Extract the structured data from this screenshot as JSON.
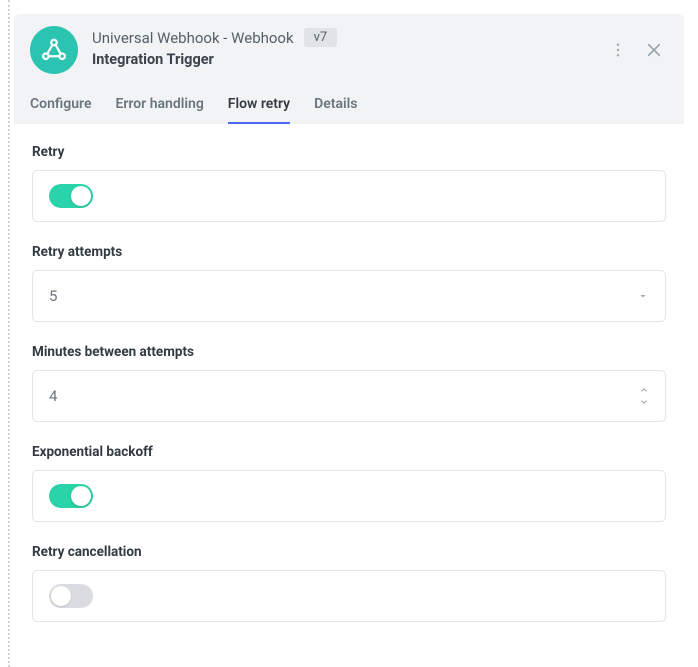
{
  "header": {
    "title": "Universal Webhook - Webhook",
    "version": "v7",
    "subtitle": "Integration Trigger"
  },
  "tabs": [
    {
      "label": "Configure",
      "active": false
    },
    {
      "label": "Error handling",
      "active": false
    },
    {
      "label": "Flow retry",
      "active": true
    },
    {
      "label": "Details",
      "active": false
    }
  ],
  "fields": {
    "retry": {
      "label": "Retry",
      "value": true
    },
    "retry_attempts": {
      "label": "Retry attempts",
      "value": "5"
    },
    "minutes_between": {
      "label": "Minutes between attempts",
      "value": "4"
    },
    "exponential_backoff": {
      "label": "Exponential backoff",
      "value": true
    },
    "retry_cancellation": {
      "label": "Retry cancellation",
      "value": false
    }
  }
}
